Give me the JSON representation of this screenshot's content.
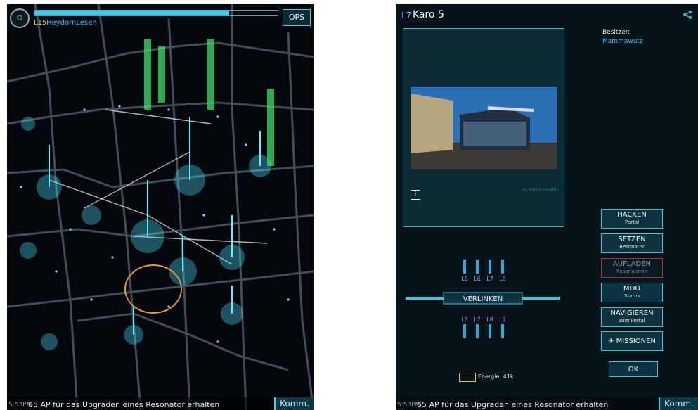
{
  "left_screen": {
    "agent_icon": "agent-emblem-icon",
    "xm_fill": 0.8,
    "level": "L15",
    "agent_name": "HeydornLesen",
    "ops_label": "OPS",
    "status": {
      "time": "5:53PM",
      "message": "65 AP für das Upgraden eines Resonator erhalten"
    },
    "komm_label": "Komm."
  },
  "right_screen": {
    "portal_level": "L7",
    "portal_title": "Karo 5",
    "share_icon": "share-icon",
    "photo_credit": "by Portal Creator",
    "owner_label": "Besitzer:",
    "owner_name": "Mammawutz",
    "buttons": [
      {
        "l1": "HACKEN",
        "l2": "Portal"
      },
      {
        "l1": "SETZEN",
        "l2": "Resonator"
      },
      {
        "l1": "AUFLADEN",
        "l2": "Resonatoren",
        "disabled": true
      },
      {
        "l1": "MOD",
        "l2": "Status"
      },
      {
        "l1": "NAVIGIEREN",
        "l2": "zum Portal"
      },
      {
        "l1": "✈ MISSIONEN",
        "l2": ""
      }
    ],
    "ok_label": "OK",
    "link_label": "VERLINKEN",
    "resonators_top": [
      "L6",
      "L6",
      "L7",
      "L8"
    ],
    "resonators_bottom": [
      "L8",
      "L7",
      "L8",
      "L7"
    ],
    "energy": "Energie: 41k",
    "status": {
      "time": "5:53PM",
      "message": "65 AP für das Upgraden eines Resonator erhalten"
    },
    "komm_label": "Komm.",
    "colors": {
      "accent": "#3fc5d4",
      "resistance": "#29c6f7",
      "enlightened": "#39d36a"
    }
  }
}
